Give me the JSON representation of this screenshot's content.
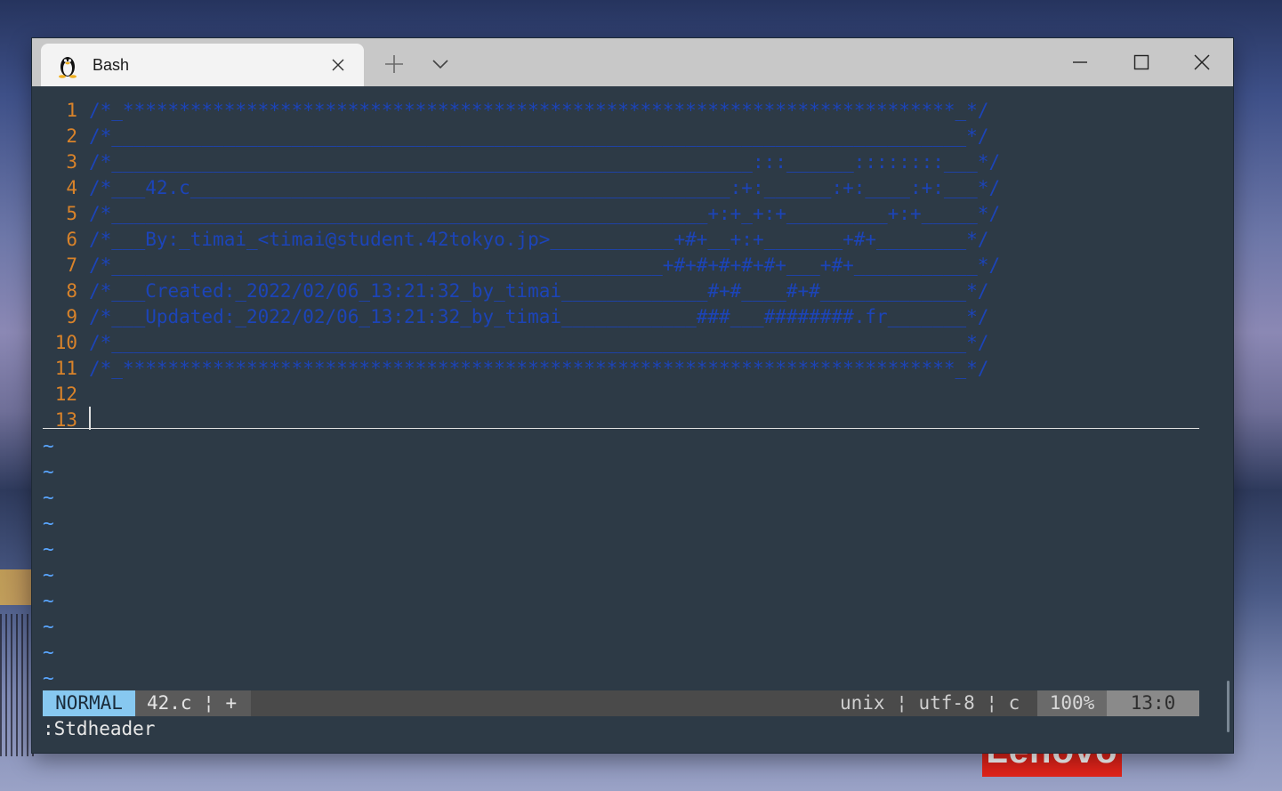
{
  "tab": {
    "title": "Bash",
    "icon": "linux-penguin-icon"
  },
  "brand": {
    "badge_text": "Lenovo"
  },
  "editor": {
    "lines": [
      {
        "num": "1",
        "text": "/*_**************************************************************************_*/"
      },
      {
        "num": "2",
        "text": "/*____________________________________________________________________________*/"
      },
      {
        "num": "3",
        "text": "/*_________________________________________________________:::______::::::::___*/"
      },
      {
        "num": "4",
        "text": "/*___42.c________________________________________________:+:______:+:____:+:___*/"
      },
      {
        "num": "5",
        "text": "/*_____________________________________________________+:+_+:+_________+:+_____*/"
      },
      {
        "num": "6",
        "text": "/*___By:_timai_<timai@student.42tokyo.jp>___________+#+__+:+_______+#+________*/"
      },
      {
        "num": "7",
        "text": "/*_________________________________________________+#+#+#+#+#+___+#+___________*/"
      },
      {
        "num": "8",
        "text": "/*___Created:_2022/02/06_13:21:32_by_timai_____________#+#____#+#_____________*/"
      },
      {
        "num": "9",
        "text": "/*___Updated:_2022/02/06_13:21:32_by_timai____________###___########.fr_______*/"
      },
      {
        "num": "10",
        "text": "/*____________________________________________________________________________*/"
      },
      {
        "num": "11",
        "text": "/*_**************************************************************************_*/"
      },
      {
        "num": "12",
        "text": ""
      },
      {
        "num": "13",
        "text": ""
      }
    ],
    "tilde": "~"
  },
  "statusline": {
    "mode": "NORMAL",
    "file": "42.c ¦ +",
    "format": "unix ¦ utf-8 ¦ c",
    "percent": "100%",
    "position": "13:0"
  },
  "cmdline": ":Stdheader",
  "colors": {
    "line_number": "#d9832a",
    "comment": "#1c44b8",
    "tilde": "#5aa6ff",
    "mode_bg": "#87c8f0",
    "terminal_bg": "#2d3a46"
  }
}
